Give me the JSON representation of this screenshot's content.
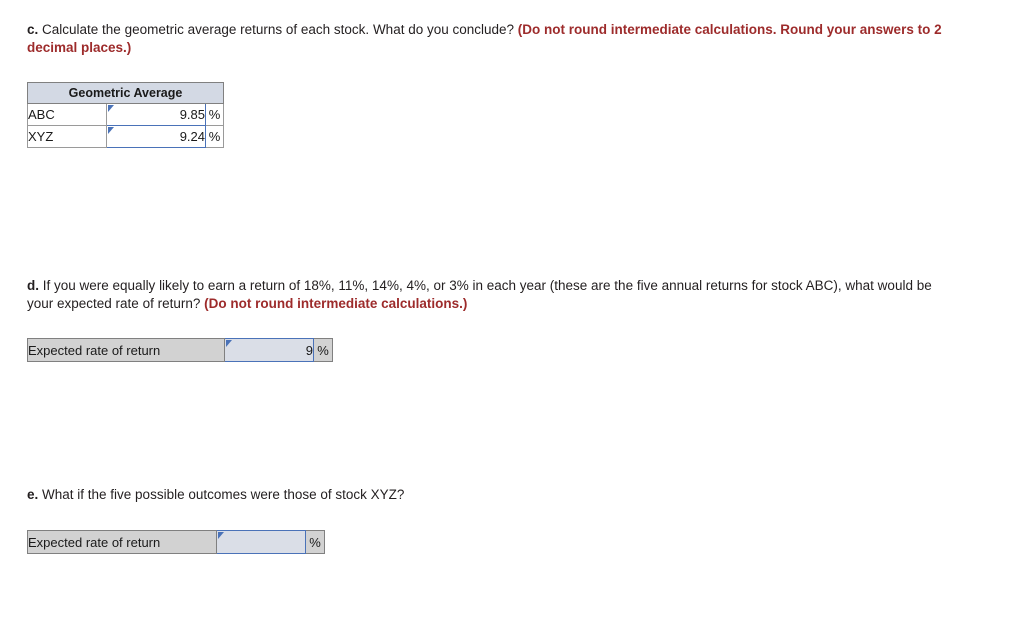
{
  "questions": {
    "c": {
      "label": "c.",
      "text": " Calculate the geometric average returns of each stock. What do you conclude? ",
      "accent": "(Do not round intermediate calculations. Round your answers to 2 decimal places.)"
    },
    "d": {
      "label": "d.",
      "text": " If you were equally likely to earn a return of 18%, 11%, 14%, 4%, or 3% in each year (these are the five annual returns for stock ABC), what would be your expected rate of return? ",
      "accent": "(Do not round intermediate calculations.)"
    },
    "e": {
      "label": "e.",
      "text": " What if the five possible outcomes were those of stock XYZ?"
    }
  },
  "geometric_average_table": {
    "header": "Geometric Average",
    "rows": [
      {
        "name": "ABC",
        "value": "9.85",
        "unit": "%"
      },
      {
        "name": "XYZ",
        "value": "9.24",
        "unit": "%"
      }
    ]
  },
  "expected_return_d": {
    "label": "Expected rate of return",
    "value": "9",
    "unit": "%"
  },
  "expected_return_e": {
    "label": "Expected rate of return",
    "value": "",
    "unit": "%"
  },
  "colors": {
    "accent_red": "#9d2b2b",
    "input_border_blue": "#4a72b8",
    "input_fill": "#dadee7",
    "header_fill": "#d3d9e4",
    "shaded_label_fill": "#d2d2d2"
  }
}
